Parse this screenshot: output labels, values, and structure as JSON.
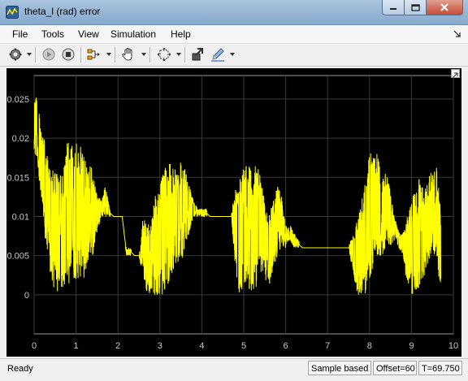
{
  "window": {
    "title": "theta_l (rad) error"
  },
  "menu": [
    "File",
    "Tools",
    "View",
    "Simulation",
    "Help"
  ],
  "toolbar": {
    "icons": [
      "gear-icon",
      "run-icon",
      "stop-icon",
      "signal-select-icon",
      "pan-hand-icon",
      "zoom-fit-icon",
      "highlight-block-icon",
      "style-pen-icon"
    ]
  },
  "colors": {
    "plot_bg": "#000000",
    "axes_bg": "#000000",
    "trace": "#ffff00",
    "grid": "#3a3a3a",
    "axis_text": "#c8c8c8"
  },
  "chart_data": {
    "type": "line",
    "title": "",
    "xlabel": "",
    "ylabel": "",
    "xlim": [
      0,
      10
    ],
    "ylim": [
      -0.005,
      0.028
    ],
    "xticks": [
      "0",
      "1",
      "2",
      "3",
      "4",
      "5",
      "6",
      "7",
      "8",
      "9",
      "10"
    ],
    "yticks": [
      "0",
      "0.005",
      "0.01",
      "0.015",
      "0.02",
      "0.025"
    ],
    "grid": true,
    "series": [
      {
        "name": "",
        "envelope": {
          "x": [
            0.0,
            0.05,
            0.1,
            0.2,
            0.3,
            0.4,
            0.5,
            0.6,
            0.7,
            0.8,
            0.9,
            1.0,
            1.1,
            1.2,
            1.3,
            1.4,
            1.5,
            1.6,
            1.7,
            1.8,
            1.9,
            2.0,
            2.1,
            2.2,
            2.3,
            2.4,
            2.5,
            2.6,
            2.7,
            2.8,
            2.9,
            3.0,
            3.1,
            3.2,
            3.3,
            3.4,
            3.5,
            3.6,
            3.7,
            3.8,
            3.9,
            4.0,
            4.1,
            4.2,
            4.3,
            4.4,
            4.5,
            4.6,
            4.7,
            4.8,
            4.9,
            5.0,
            5.1,
            5.2,
            5.3,
            5.4,
            5.5,
            5.6,
            5.7,
            5.8,
            5.9,
            6.0,
            6.1,
            6.2,
            6.3,
            6.4,
            6.5,
            6.6,
            6.7,
            6.8,
            6.9,
            7.0,
            7.1,
            7.2,
            7.3,
            7.4,
            7.5,
            7.6,
            7.7,
            7.8,
            7.9,
            8.0,
            8.1,
            8.2,
            8.3,
            8.4,
            8.5,
            8.6,
            8.7,
            8.8,
            8.9,
            9.0,
            9.1,
            9.2,
            9.3,
            9.4,
            9.5,
            9.6,
            9.7
          ],
          "high": [
            0.026,
            0.026,
            0.024,
            0.021,
            0.018,
            0.016,
            0.016,
            0.015,
            0.016,
            0.02,
            0.019,
            0.02,
            0.019,
            0.018,
            0.017,
            0.016,
            0.013,
            0.012,
            0.014,
            0.011,
            0.01,
            0.01,
            0.01,
            0.006,
            0.006,
            0.005,
            0.005,
            0.01,
            0.009,
            0.01,
            0.013,
            0.014,
            0.016,
            0.017,
            0.018,
            0.016,
            0.017,
            0.016,
            0.014,
            0.012,
            0.011,
            0.011,
            0.011,
            0.01,
            0.01,
            0.01,
            0.01,
            0.01,
            0.01,
            0.014,
            0.015,
            0.017,
            0.017,
            0.016,
            0.017,
            0.015,
            0.012,
            0.01,
            0.012,
            0.014,
            0.013,
            0.009,
            0.009,
            0.008,
            0.007,
            0.006,
            0.006,
            0.006,
            0.006,
            0.006,
            0.006,
            0.006,
            0.006,
            0.006,
            0.006,
            0.006,
            0.006,
            0.008,
            0.01,
            0.012,
            0.016,
            0.018,
            0.019,
            0.018,
            0.015,
            0.016,
            0.013,
            0.01,
            0.008,
            0.008,
            0.01,
            0.012,
            0.014,
            0.015,
            0.013,
            0.015,
            0.016,
            0.017,
            0.011
          ],
          "low": [
            0.018,
            0.017,
            0.016,
            0.01,
            0.005,
            0.002,
            0.0,
            0.0,
            0.001,
            0.001,
            0.002,
            0.002,
            0.002,
            0.002,
            0.004,
            0.005,
            0.008,
            0.01,
            0.01,
            0.01,
            0.01,
            0.01,
            0.01,
            0.005,
            0.005,
            0.005,
            0.005,
            0.002,
            0.0,
            0.0,
            0.0,
            0.0,
            0.0,
            0.001,
            0.003,
            0.004,
            0.004,
            0.006,
            0.008,
            0.01,
            0.01,
            0.01,
            0.01,
            0.01,
            0.01,
            0.01,
            0.01,
            0.01,
            0.01,
            0.003,
            0.0,
            0.0,
            0.0,
            0.0,
            0.001,
            0.003,
            0.002,
            0.001,
            0.003,
            0.005,
            0.006,
            0.006,
            0.007,
            0.006,
            0.006,
            0.006,
            0.006,
            0.006,
            0.006,
            0.006,
            0.006,
            0.006,
            0.006,
            0.006,
            0.006,
            0.006,
            0.006,
            0.003,
            0.0,
            0.0,
            0.0,
            0.002,
            0.004,
            0.005,
            0.005,
            0.006,
            0.006,
            0.007,
            0.006,
            0.005,
            0.001,
            0.0,
            0.0,
            0.001,
            0.002,
            0.004,
            0.006,
            0.004,
            0.0
          ]
        }
      }
    ]
  },
  "status": {
    "ready": "Ready",
    "mode": "Sample based",
    "offset": "Offset=60",
    "time": "T=69.750"
  }
}
